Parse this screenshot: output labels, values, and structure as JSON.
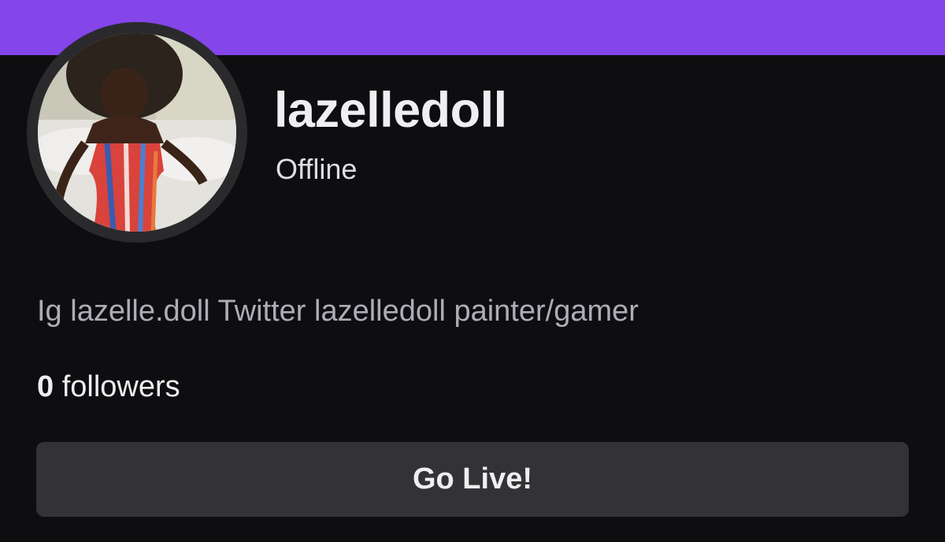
{
  "colors": {
    "banner": "#8445e9",
    "background": "#0e0e10",
    "button": "#333336"
  },
  "profile": {
    "avatar_icon": "avatar-photo",
    "username": "lazelledoll",
    "status": "Offline",
    "bio": "Ig lazelle.doll Twitter lazelledoll painter/gamer",
    "followers_count": "0",
    "followers_label": "followers"
  },
  "actions": {
    "go_live_label": "Go Live!"
  }
}
